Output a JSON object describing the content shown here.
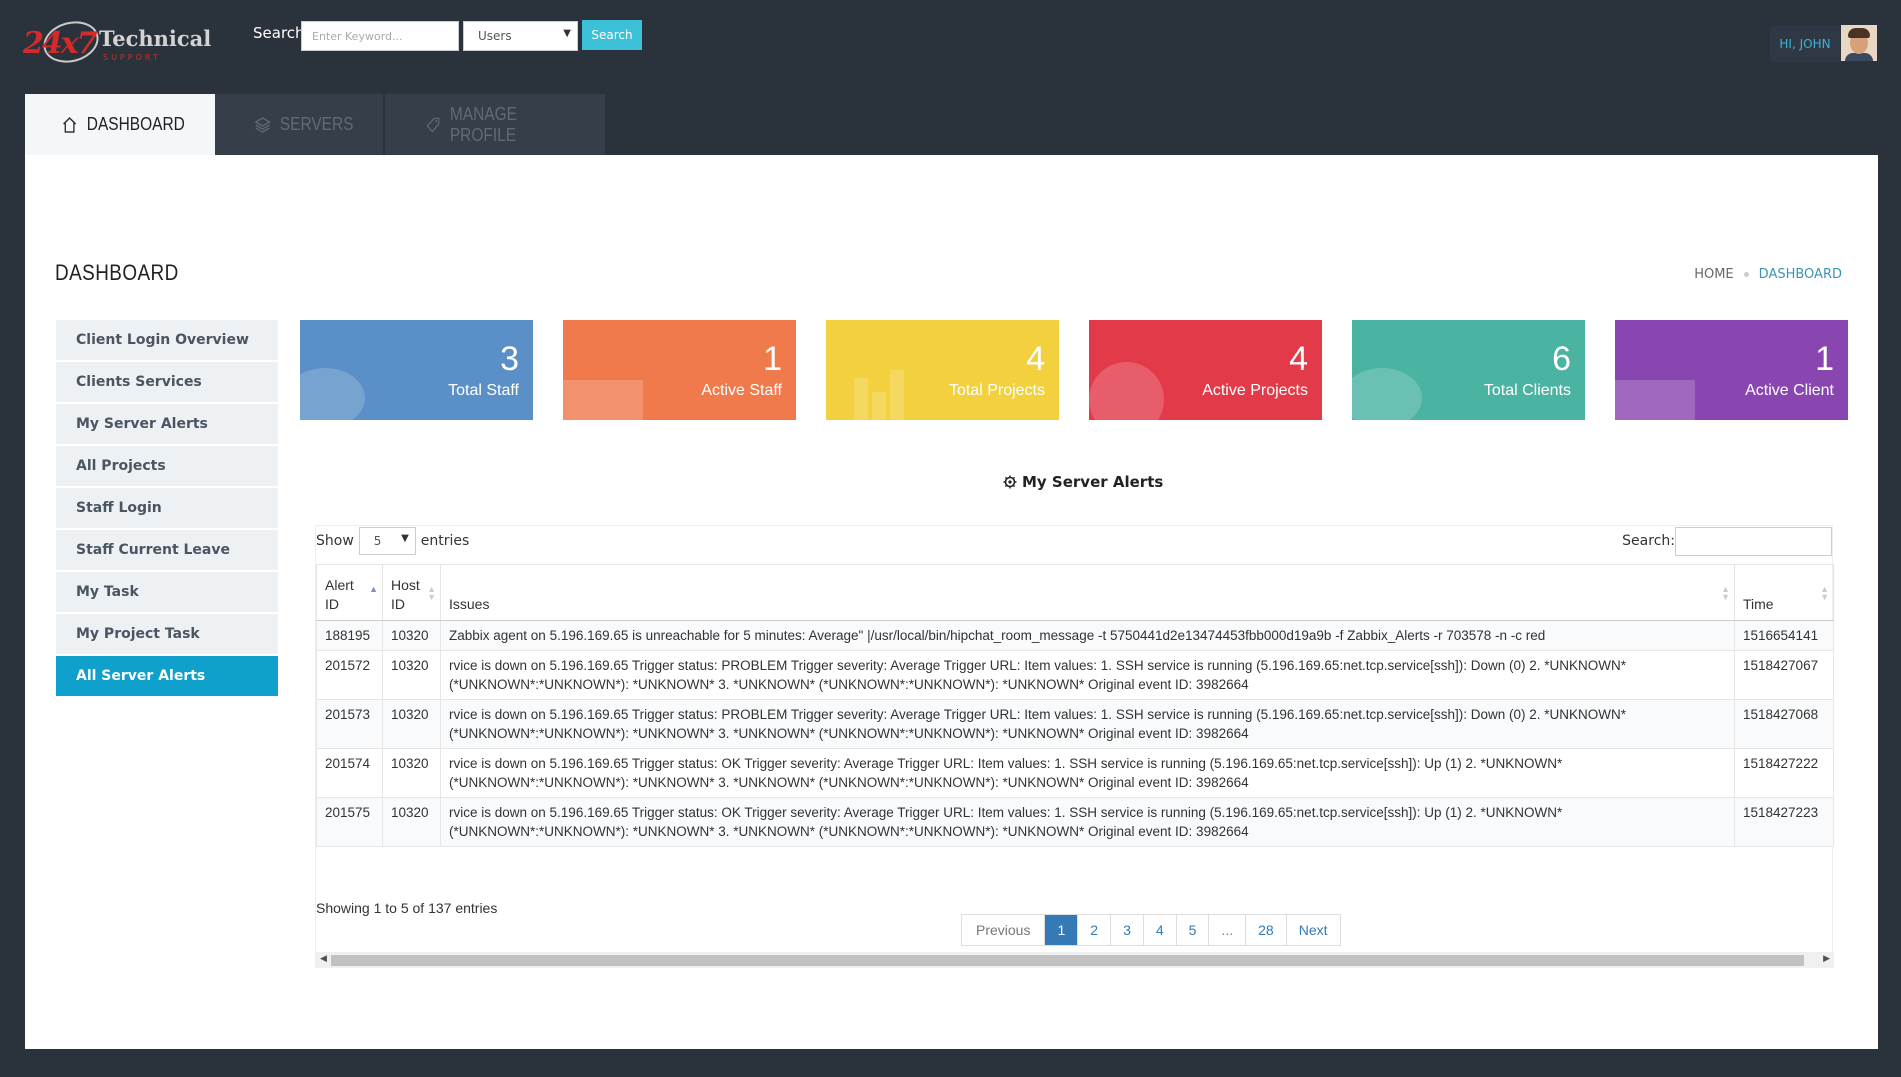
{
  "header": {
    "logo": {
      "number": "24x7",
      "brand": "Technical",
      "tagline": "SUPPORT"
    },
    "search_label": "Search",
    "search_placeholder": "Enter Keyword...",
    "search_scope": "Users",
    "search_button": "Search",
    "user_greeting": "HI, JOHN"
  },
  "nav": {
    "tabs": [
      {
        "label": "DASHBOARD",
        "icon": "home-icon"
      },
      {
        "label": "SERVERS",
        "icon": "layers-icon"
      },
      {
        "label": "MANAGE PROFILE",
        "icon": "tag-icon"
      }
    ]
  },
  "page": {
    "title": "DASHBOARD",
    "breadcrumb": [
      "HOME",
      "DASHBOARD"
    ]
  },
  "sidebar": {
    "items": [
      "Client Login Overview",
      "Clients Services",
      "My Server Alerts",
      "All Projects",
      "Staff Login",
      "Staff Current Leave",
      "My Task",
      "My Project Task",
      "All Server Alerts"
    ],
    "active_index": 8
  },
  "stats": [
    {
      "value": "3",
      "label": "Total Staff",
      "color": "#5a8fc7"
    },
    {
      "value": "1",
      "label": "Active Staff",
      "color": "#f07a4c"
    },
    {
      "value": "4",
      "label": "Total Projects",
      "color": "#f3d03e"
    },
    {
      "value": "4",
      "label": "Active Projects",
      "color": "#e23a49"
    },
    {
      "value": "6",
      "label": "Total Clients",
      "color": "#4ab3a2"
    },
    {
      "value": "1",
      "label": "Active Client",
      "color": "#8a46b0"
    }
  ],
  "alerts": {
    "title": "My Server Alerts",
    "show_label": "Show",
    "entries_value": "5",
    "entries_label": "entries",
    "search_label": "Search:",
    "columns": [
      "Alert ID",
      "Host ID",
      "Issues",
      "Time"
    ],
    "rows": [
      {
        "alert_id": "188195",
        "host_id": "10320",
        "issue": "Zabbix agent on 5.196.169.65 is unreachable for 5 minutes: Average\" |/usr/local/bin/hipchat_room_message -t 5750441d2e13474453fbb000d19a9b -f Zabbix_Alerts -r 703578 -n -c red",
        "time": "1516654141"
      },
      {
        "alert_id": "201572",
        "host_id": "10320",
        "issue": "rvice is down on 5.196.169.65 Trigger status: PROBLEM Trigger severity: Average Trigger URL: Item values: 1. SSH service is running (5.196.169.65:net.tcp.service[ssh]): Down (0) 2. *UNKNOWN* (*UNKNOWN*:*UNKNOWN*): *UNKNOWN* 3. *UNKNOWN* (*UNKNOWN*:*UNKNOWN*): *UNKNOWN* Original event ID: 3982664",
        "time": "1518427067"
      },
      {
        "alert_id": "201573",
        "host_id": "10320",
        "issue": "rvice is down on 5.196.169.65 Trigger status: PROBLEM Trigger severity: Average Trigger URL: Item values: 1. SSH service is running (5.196.169.65:net.tcp.service[ssh]): Down (0) 2. *UNKNOWN* (*UNKNOWN*:*UNKNOWN*): *UNKNOWN* 3. *UNKNOWN* (*UNKNOWN*:*UNKNOWN*): *UNKNOWN* Original event ID: 3982664",
        "time": "1518427068"
      },
      {
        "alert_id": "201574",
        "host_id": "10320",
        "issue": "rvice is down on 5.196.169.65 Trigger status: OK Trigger severity: Average Trigger URL: Item values: 1. SSH service is running (5.196.169.65:net.tcp.service[ssh]): Up (1) 2. *UNKNOWN* (*UNKNOWN*:*UNKNOWN*): *UNKNOWN* 3. *UNKNOWN* (*UNKNOWN*:*UNKNOWN*): *UNKNOWN* Original event ID: 3982664",
        "time": "1518427222"
      },
      {
        "alert_id": "201575",
        "host_id": "10320",
        "issue": "rvice is down on 5.196.169.65 Trigger status: OK Trigger severity: Average Trigger URL: Item values: 1. SSH service is running (5.196.169.65:net.tcp.service[ssh]): Up (1) 2. *UNKNOWN* (*UNKNOWN*:*UNKNOWN*): *UNKNOWN* 3. *UNKNOWN* (*UNKNOWN*:*UNKNOWN*): *UNKNOWN* Original event ID: 3982664",
        "time": "1518427223"
      }
    ],
    "showing_text": "Showing 1 to 5 of 137 entries",
    "pagination": [
      "Previous",
      "1",
      "2",
      "3",
      "4",
      "5",
      "...",
      "28",
      "Next"
    ],
    "active_page": "1"
  }
}
